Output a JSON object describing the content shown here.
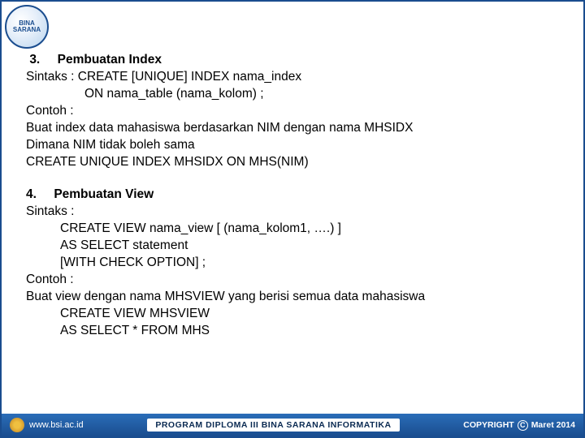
{
  "logo_text": "BINA\nSARANA",
  "sections": [
    {
      "number": "3.",
      "title": "Pembuatan Index",
      "lines": [
        {
          "text": "Sintaks : CREATE [UNIQUE] INDEX  nama_index",
          "indent": ""
        },
        {
          "text": "ON nama_table (nama_kolom) ;",
          "indent": "indent1"
        },
        {
          "text": "Contoh :",
          "indent": ""
        },
        {
          "text": "Buat index data mahasiswa berdasarkan NIM dengan nama MHSIDX",
          "indent": ""
        },
        {
          "text": "Dimana NIM tidak boleh sama",
          "indent": ""
        },
        {
          "text": "CREATE UNIQUE  INDEX MHSIDX ON MHS(NIM)",
          "indent": ""
        }
      ]
    },
    {
      "number": "4.",
      "title": "Pembuatan View",
      "lines": [
        {
          "text": "Sintaks :",
          "indent": ""
        },
        {
          "text": "CREATE VIEW nama_view [ (nama_kolom1, ….) ]",
          "indent": "indent2"
        },
        {
          "text": "AS SELECT statement",
          "indent": "indent2"
        },
        {
          "text": "[WITH CHECK OPTION] ;",
          "indent": "indent2"
        },
        {
          "text": "Contoh :",
          "indent": ""
        },
        {
          "text": "Buat view dengan nama MHSVIEW yang berisi semua data mahasiswa",
          "indent": ""
        },
        {
          "text": "CREATE VIEW MHSVIEW",
          "indent": "indent2"
        },
        {
          "text": "AS SELECT * FROM MHS",
          "indent": "indent2"
        }
      ]
    }
  ],
  "footer": {
    "url": "www.bsi.ac.id",
    "program": "PROGRAM DIPLOMA III BINA SARANA INFORMATIKA",
    "copyright_label": "COPYRIGHT",
    "copyright_symbol": "C",
    "date": "Maret 2014"
  }
}
